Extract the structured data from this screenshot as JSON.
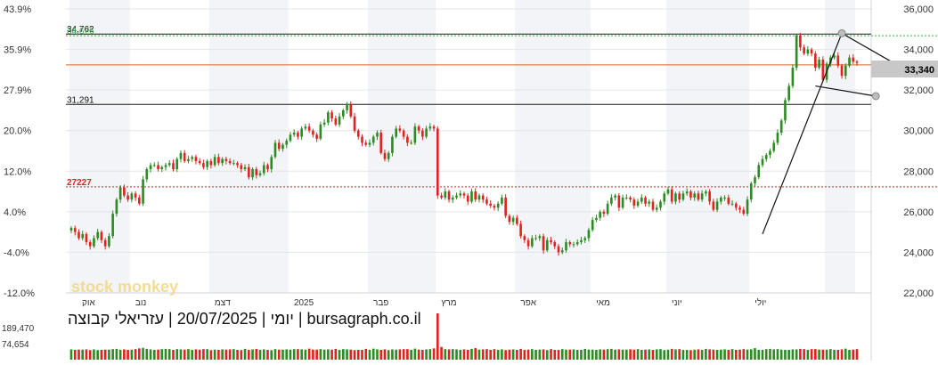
{
  "header": {
    "caption": "יומי | 20/07/2025 | עזריאלי קבוצה | bursagraph.co.il",
    "watermark": "stock monkey"
  },
  "colors": {
    "up": "#2e8b24",
    "down": "#e0231f",
    "price_tag_bg": "#c8c8c8",
    "band": "#f2f4f7",
    "grid": "#e3e6ea",
    "line_orange": "#d2691e",
    "line_black": "#1a1a1a",
    "dotted_red": "#e0231f",
    "dotted_green": "#3cb043",
    "watermark": "#f2d98a"
  },
  "chart_data": {
    "type": "candlestick",
    "ylim": [
      22000,
      36000
    ],
    "y_ticks_right": [
      "36,000",
      "34,000",
      "32,000",
      "30,000",
      "28,000",
      "26,000",
      "24,000",
      "22,000"
    ],
    "y_ticks_left": [
      "43.9%",
      "35.9%",
      "27.9%",
      "20.0%",
      "12.0%",
      "4.0%",
      "-4.0%",
      "-12.0%"
    ],
    "x_month_labels": [
      "אוק",
      "נוב",
      "דצמ",
      "2025",
      "פבר",
      "מרץ",
      "אפר",
      "מאי",
      "יוני",
      "יולי"
    ],
    "last_price_label": "33,340",
    "last_price": 33340,
    "horizontal_levels": [
      {
        "label": "34,762",
        "value": 34762,
        "style": "solid-black"
      },
      {
        "label": "34,676",
        "value": 34676,
        "style": "dotted-green"
      },
      {
        "label": "",
        "value": 33240,
        "style": "solid-orange"
      },
      {
        "label": "31,291",
        "value": 31291,
        "style": "solid-black"
      },
      {
        "label": "27227",
        "value": 27227,
        "style": "dotted-red"
      }
    ],
    "volume_labels": [
      "189,470",
      "74,654"
    ],
    "closes": [
      25200,
      25000,
      24700,
      24900,
      24500,
      24300,
      24700,
      25000,
      24600,
      24300,
      24800,
      25900,
      26600,
      27200,
      26800,
      26600,
      26900,
      26700,
      26400,
      27600,
      28100,
      28300,
      28300,
      28100,
      28200,
      28300,
      28400,
      28100,
      28600,
      28900,
      28500,
      28600,
      28700,
      28500,
      28400,
      28200,
      28500,
      28300,
      28700,
      28400,
      28600,
      28500,
      28400,
      28400,
      28300,
      28100,
      28200,
      27700,
      28100,
      27800,
      27900,
      28300,
      28100,
      28700,
      29400,
      29100,
      29300,
      29500,
      29800,
      29900,
      29700,
      30100,
      30200,
      30000,
      29800,
      29600,
      30300,
      30400,
      30900,
      30600,
      30300,
      30700,
      31000,
      31300,
      30700,
      30000,
      29700,
      29400,
      29300,
      29400,
      29700,
      29900,
      28900,
      28600,
      28900,
      29700,
      30100,
      30000,
      29700,
      29400,
      29400,
      30200,
      30000,
      29700,
      30100,
      30200,
      30100,
      26800,
      26700,
      27000,
      26600,
      26700,
      26800,
      26900,
      26800,
      26500,
      27000,
      26600,
      26800,
      26600,
      26400,
      26300,
      26200,
      26400,
      26700,
      25800,
      25500,
      25700,
      25400,
      24800,
      24600,
      24300,
      24700,
      24700,
      24800,
      24100,
      24600,
      24500,
      24300,
      24000,
      24100,
      24500,
      24400,
      24400,
      24500,
      24600,
      24700,
      25100,
      25600,
      25700,
      26000,
      25900,
      26400,
      26700,
      26800,
      26200,
      26700,
      26700,
      26600,
      26300,
      26500,
      26700,
      26400,
      26500,
      26100,
      26200,
      26500,
      26900,
      27100,
      26500,
      26900,
      26600,
      26900,
      27000,
      26700,
      26900,
      26600,
      26900,
      27000,
      26500,
      26100,
      26500,
      26700,
      26700,
      26400,
      26400,
      26200,
      26100,
      25900,
      26600,
      27400,
      27700,
      28300,
      28600,
      28800,
      29000,
      29400,
      29900,
      30500,
      31500,
      32200,
      33100,
      34700,
      34100,
      33800,
      34000,
      33800,
      33100,
      33500,
      32500,
      33300,
      33600,
      33700,
      33200,
      32700,
      33200,
      33600,
      33400,
      33340
    ],
    "volumes": [
      42,
      40,
      41,
      41,
      42,
      39,
      42,
      39,
      40,
      41,
      41,
      43,
      44,
      40,
      42,
      40,
      41,
      43,
      46,
      48,
      44,
      42,
      40,
      41,
      43,
      44,
      43,
      40,
      43,
      42,
      41,
      43,
      40,
      42,
      41,
      43,
      43,
      39,
      41,
      40,
      42,
      41,
      42,
      43,
      40,
      39,
      44,
      40,
      42,
      44,
      40,
      42,
      40,
      39,
      43,
      41,
      41,
      42,
      41,
      43,
      43,
      42,
      41,
      45,
      41,
      41,
      43,
      41,
      42,
      41,
      44,
      40,
      43,
      42,
      41,
      39,
      40,
      40,
      44,
      40,
      45,
      42,
      40,
      42,
      39,
      42,
      41,
      42,
      43,
      43,
      40,
      45,
      41,
      40,
      42,
      43,
      46,
      189,
      52,
      43,
      42,
      43,
      42,
      40,
      42,
      40,
      44,
      47,
      41,
      42,
      43,
      40,
      43,
      40,
      42,
      39,
      41,
      42,
      40,
      44,
      40,
      41,
      43,
      40,
      41,
      42,
      39,
      43,
      40,
      40,
      43,
      41,
      41,
      42,
      40,
      40,
      44,
      41,
      41,
      40,
      42,
      41,
      43,
      44,
      41,
      42,
      41,
      41,
      42,
      41,
      43,
      40,
      41,
      42,
      40,
      42,
      43,
      39,
      41,
      44,
      42,
      43,
      40,
      40,
      39,
      41,
      42,
      40,
      44,
      42,
      41,
      40,
      41,
      42,
      40,
      43,
      40,
      41,
      43,
      41,
      42,
      47,
      40,
      40,
      43,
      44,
      42,
      43,
      41,
      40,
      40,
      42,
      42,
      44,
      43,
      40,
      43,
      43,
      41,
      41,
      41,
      43,
      40,
      40,
      42,
      45,
      40,
      41,
      43
    ]
  }
}
